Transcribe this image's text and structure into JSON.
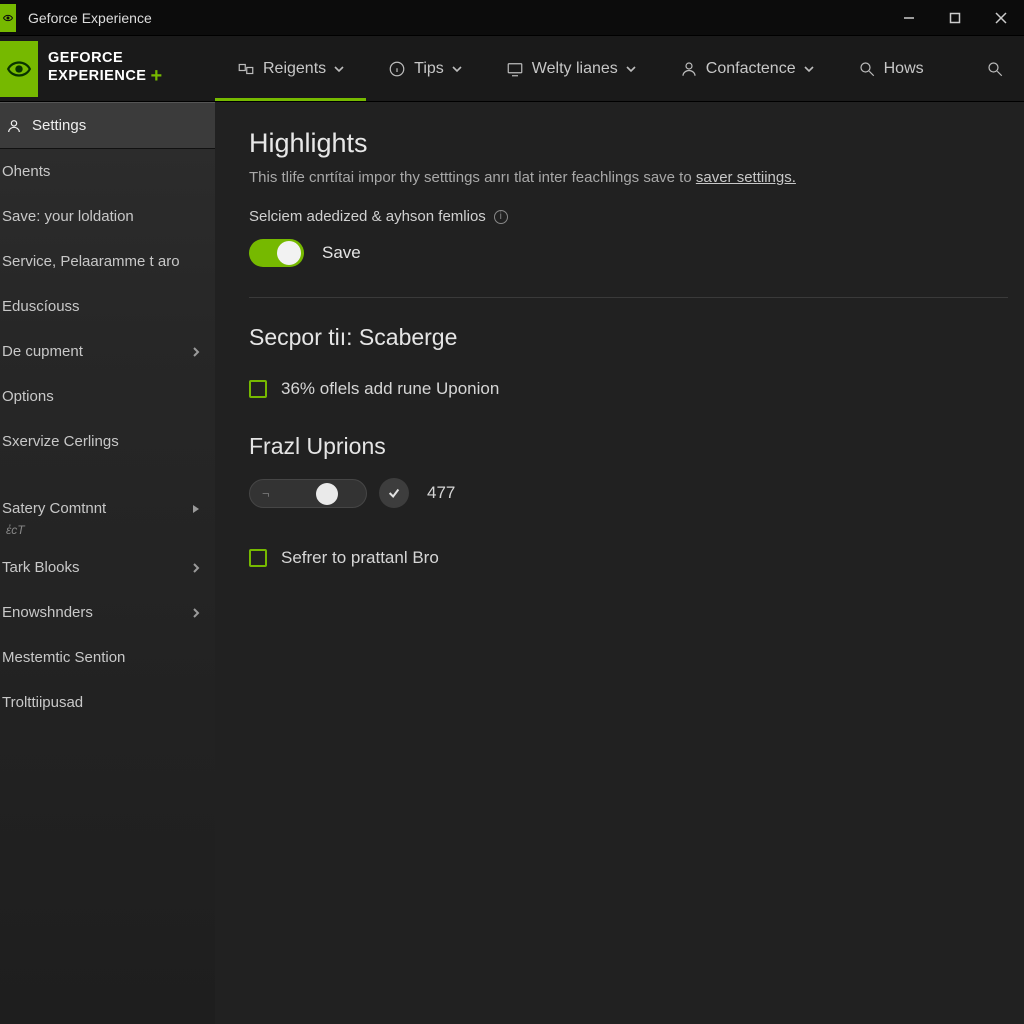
{
  "window": {
    "title": "Geforce Experience"
  },
  "brand": {
    "line1": "GEFORCE",
    "line2": "EXPERIENCE",
    "plus": "+"
  },
  "tabs": [
    {
      "label": "Reigents",
      "icon": "packages-icon",
      "dropdown": true,
      "active": true
    },
    {
      "label": "Tips",
      "icon": "info-icon",
      "dropdown": true,
      "active": false
    },
    {
      "label": "Welty lianes",
      "icon": "monitor-icon",
      "dropdown": true,
      "active": false
    },
    {
      "label": "Confactence",
      "icon": "user-icon",
      "dropdown": true,
      "active": false
    },
    {
      "label": "Hows",
      "icon": "search-icon",
      "dropdown": false,
      "active": false
    }
  ],
  "header_search_icon": "search-icon",
  "sidebar": {
    "items": [
      {
        "label": "Settings",
        "icon": "user-icon",
        "active": true,
        "arrow": false
      },
      {
        "label": "Ohents",
        "icon": null,
        "active": false,
        "arrow": false
      },
      {
        "label": "Save: your loldation",
        "icon": null,
        "active": false,
        "arrow": false
      },
      {
        "label": "Service, Pelaaramme t aro",
        "icon": null,
        "active": false,
        "arrow": false
      },
      {
        "label": "Eduscíouss",
        "icon": null,
        "active": false,
        "arrow": false
      },
      {
        "label": "De cupment",
        "icon": null,
        "active": false,
        "arrow": true
      },
      {
        "label": "Options",
        "icon": null,
        "active": false,
        "arrow": false
      },
      {
        "label": "Sxervize Cerlings",
        "icon": null,
        "active": false,
        "arrow": false
      },
      {
        "label": "Satery Comtnnt",
        "icon": null,
        "active": false,
        "arrow": "tri",
        "sub": "ἐcT"
      },
      {
        "label": "Tark Blooks",
        "icon": null,
        "active": false,
        "arrow": true
      },
      {
        "label": "Enowshnders",
        "icon": null,
        "active": false,
        "arrow": true
      },
      {
        "label": "Mestemtic Sention",
        "icon": null,
        "active": false,
        "arrow": false
      },
      {
        "label": "Trolttiipusad",
        "icon": null,
        "active": false,
        "arrow": false
      }
    ]
  },
  "main": {
    "highlights": {
      "title": "Highlights",
      "desc_prefix": "This tlife cnrtítai impor thy setttings anrı tlat inter feachlings save to ",
      "desc_link": "saver settiings.",
      "subline": "Selciem adedized & ayhson femlios",
      "toggle_on": true,
      "toggle_label": "Save"
    },
    "secport": {
      "title": "Secpor tiı: Scaberge",
      "check_label": "36% oflels add rune Uponion",
      "checked": false
    },
    "frazl": {
      "title": "Frazl Uprions",
      "value": "477",
      "check_label": "Sefrer to prattanl Bro",
      "checked": false
    }
  },
  "colors": {
    "accent": "#76b900",
    "bg": "#1a1a1a",
    "panel": "#212121"
  }
}
